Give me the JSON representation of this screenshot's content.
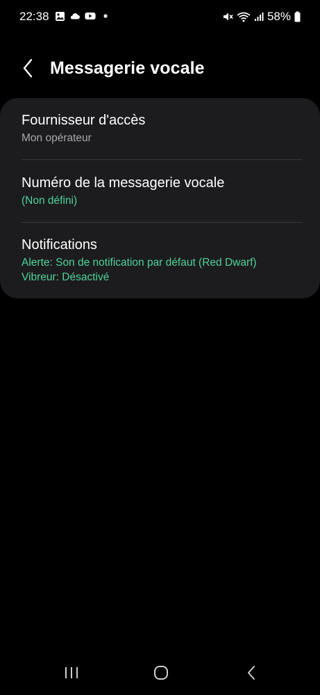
{
  "status_bar": {
    "time": "22:38",
    "battery": "58%",
    "left_icons": [
      "gallery-icon",
      "cloud-icon",
      "youtube-icon",
      "dot-icon"
    ],
    "right_icons": [
      "mute-icon",
      "wifi-icon",
      "signal-icon",
      "battery-icon"
    ]
  },
  "header": {
    "title": "Messagerie vocale",
    "back_icon": "back-chevron-icon"
  },
  "settings": {
    "items": [
      {
        "title": "Fournisseur d'accès",
        "subtitle": "Mon opérateur"
      },
      {
        "title": "Numéro de la messagerie vocale",
        "subtitle": "(Non défini)"
      },
      {
        "title": "Notifications",
        "subtitle_line1": "Alerte: Son de notification par défaut (Red Dwarf)",
        "subtitle_line2": "Vibreur: Désactivé"
      }
    ]
  },
  "nav_bar": {
    "icons": [
      "recents-icon",
      "home-icon",
      "back-icon"
    ]
  },
  "colors": {
    "background": "#000000",
    "card": "#1c1c1e",
    "accent_green": "#4fd39a",
    "secondary_text": "#a8a8ad",
    "divider": "#3a3a3c"
  }
}
